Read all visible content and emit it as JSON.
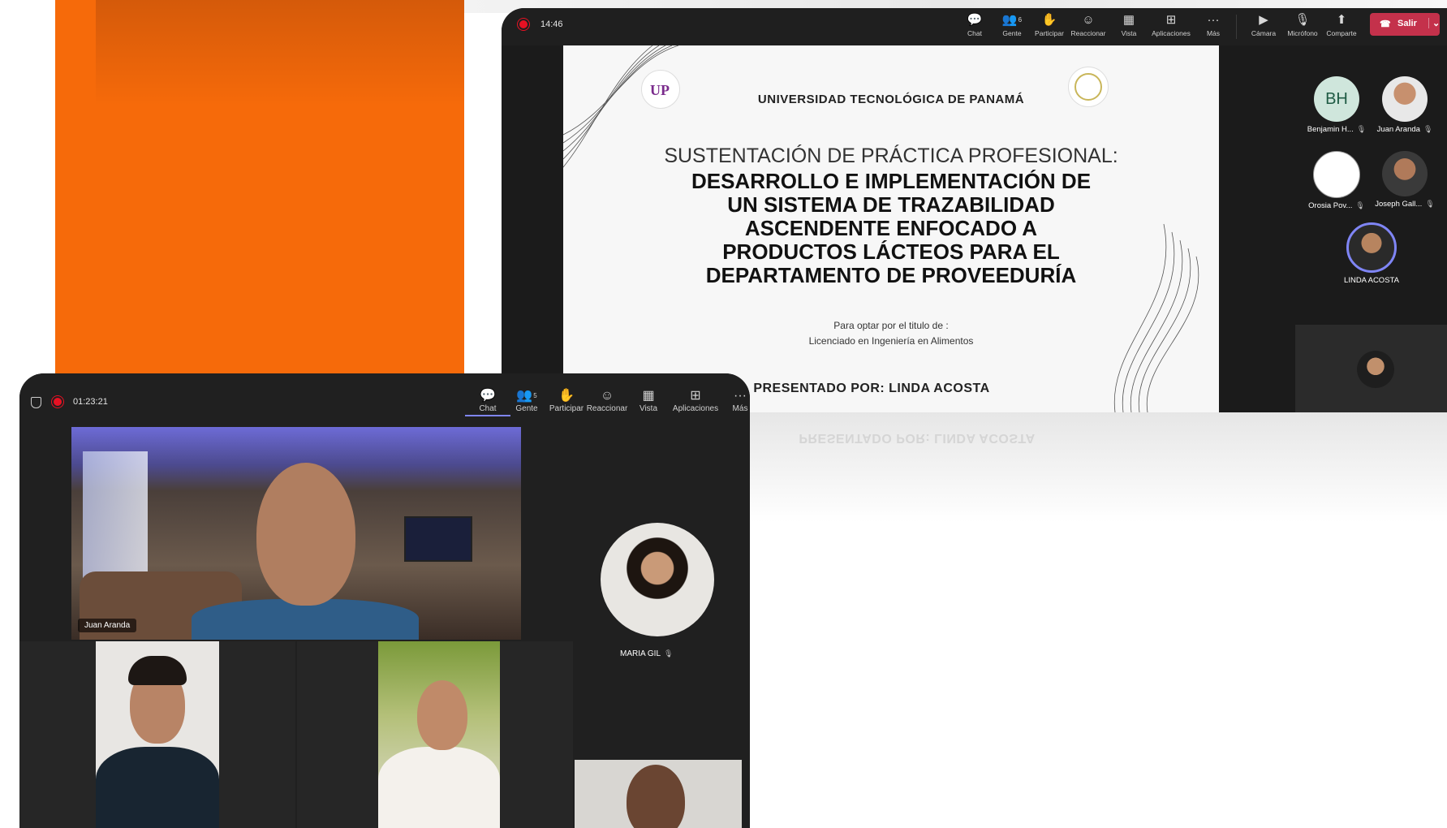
{
  "top_window": {
    "timer": "14:46",
    "toolbar": [
      {
        "label": "Chat",
        "icon": "chat-icon",
        "glyph": "💬"
      },
      {
        "label": "Gente",
        "icon": "people-icon",
        "glyph": "👥",
        "count": "6"
      },
      {
        "label": "Participar",
        "icon": "raise-hand-icon",
        "glyph": "✋"
      },
      {
        "label": "Reaccionar",
        "icon": "react-icon",
        "glyph": "☺"
      },
      {
        "label": "Vista",
        "icon": "view-icon",
        "glyph": "▦"
      },
      {
        "label": "Aplicaciones",
        "icon": "apps-icon",
        "glyph": "⊞"
      },
      {
        "label": "Más",
        "icon": "more-icon",
        "glyph": "···"
      },
      {
        "label": "Cámara",
        "icon": "camera-off-icon",
        "glyph": "▶"
      },
      {
        "label": "Micrófono",
        "icon": "mic-off-icon",
        "glyph": "🎙"
      },
      {
        "label": "Comparte",
        "icon": "share-icon",
        "glyph": "⬆"
      }
    ],
    "leave_label": "Salir",
    "slide": {
      "university": "UNIVERSIDAD TECNOLÓGICA DE PANAMÁ",
      "subtitle": "SUSTENTACIÓN DE PRÁCTICA PROFESIONAL:",
      "title": "DESARROLLO E IMPLEMENTACIÓN DE UN SISTEMA DE TRAZABILIDAD ASCENDENTE ENFOCADO A PRODUCTOS LÁCTEOS PARA EL DEPARTAMENTO DE PROVEEDURÍA",
      "optar_line1": "Para optar por el titulo de :",
      "optar_line2": "Licenciado en Ingeniería en Alimentos",
      "presented_by": "PRESENTADO POR: LINDA ACOSTA"
    },
    "participants": [
      {
        "name": "Benjamin H...",
        "initials": "BH"
      },
      {
        "name": "Juan Aranda"
      },
      {
        "name": "Orosia Pov..."
      },
      {
        "name": "Joseph Gall..."
      },
      {
        "name": "LINDA ACOSTA"
      }
    ],
    "colors": {
      "leave": "#c4314b",
      "initials_bg": "#cfe6dc",
      "initials_fg": "#1f5b44"
    }
  },
  "bottom_window": {
    "timer": "01:23:21",
    "toolbar": [
      {
        "label": "Chat",
        "icon": "chat-icon",
        "glyph": "💬"
      },
      {
        "label": "Gente",
        "icon": "people-icon",
        "glyph": "👥",
        "count": "5"
      },
      {
        "label": "Participar",
        "icon": "raise-hand-icon",
        "glyph": "✋"
      },
      {
        "label": "Reaccionar",
        "icon": "react-icon",
        "glyph": "☺"
      },
      {
        "label": "Vista",
        "icon": "view-icon",
        "glyph": "▦"
      },
      {
        "label": "Aplicaciones",
        "icon": "apps-icon",
        "glyph": "⊞"
      },
      {
        "label": "Más",
        "icon": "more-icon",
        "glyph": "···"
      }
    ],
    "main_speaker": "Juan Aranda",
    "bubble_name": "MARIA GIL"
  },
  "colors": {
    "orange": "#f66a0a",
    "accent": "#7f85f5"
  }
}
